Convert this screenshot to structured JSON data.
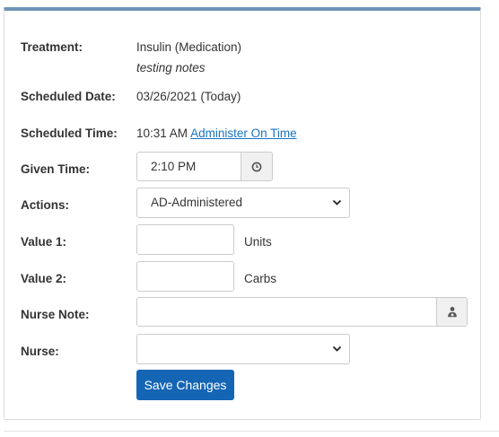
{
  "treatment": {
    "label": "Treatment:",
    "value": "Insulin (Medication)",
    "notes": "testing notes"
  },
  "scheduled_date": {
    "label": "Scheduled Date:",
    "value": "03/26/2021 (Today)"
  },
  "scheduled_time": {
    "label": "Scheduled Time:",
    "value": "10:31 AM",
    "link": "Administer On Time"
  },
  "given_time": {
    "label": "Given Time:",
    "value": "2:10 PM",
    "icon": "clock-icon"
  },
  "actions": {
    "label": "Actions:",
    "selected": "AD-Administered"
  },
  "value1": {
    "label": "Value 1:",
    "value": "",
    "unit": "Units"
  },
  "value2": {
    "label": "Value 2:",
    "value": "",
    "unit": "Carbs"
  },
  "nurse_note": {
    "label": "Nurse Note:",
    "value": "",
    "icon": "user-doctor-icon"
  },
  "nurse": {
    "label": "Nurse:",
    "selected": ""
  },
  "save_button": "Save Changes",
  "colors": {
    "accent_bar": "#6f93b7",
    "button": "#1565b5",
    "link": "#1a73c4"
  }
}
